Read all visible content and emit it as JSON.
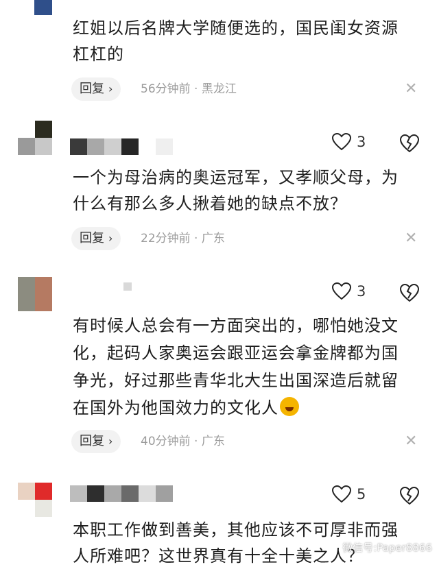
{
  "comments": [
    {
      "text": "红姐以后名牌大学随便选的，国民闺女资源\n杠杠的",
      "reply_label": "回复",
      "time": "56分钟前",
      "region": "黑龙江"
    },
    {
      "likes": "3",
      "text": "一个为母治病的奥运冠军，又孝顺父母，为\n什么有那么多人揪着她的缺点不放？",
      "reply_label": "回复",
      "time": "22分钟前",
      "region": "广东"
    },
    {
      "likes": "3",
      "text": "有时候人总会有一方面突出的，哪怕她没文\n化，起码人家奥运会跟亚运会拿金牌都为国\n争光，好过那些青华北大生出国深造后就留\n在国外为他国效力的文化人",
      "reply_label": "回复",
      "time": "40分钟前",
      "region": "广东"
    },
    {
      "likes": "5",
      "text": "本职工作做到善美，其他应该不可厚非而强\n人所难吧？这世界真有十全十美之人？"
    }
  ],
  "meta_separator": "·",
  "close_glyph": "✕",
  "watermark": "微信号:Paper8866"
}
